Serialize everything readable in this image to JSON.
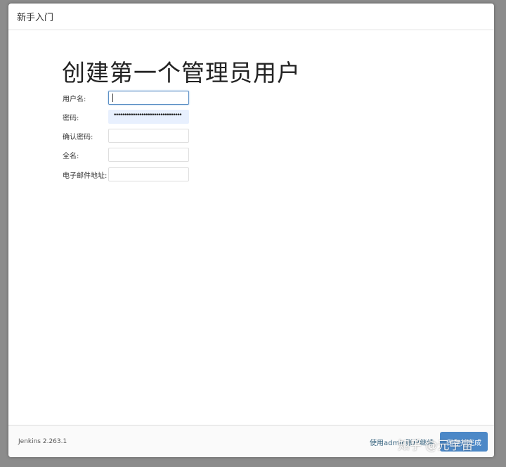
{
  "window": {
    "title": "新手入门"
  },
  "main": {
    "page_title": "创建第一个管理员用户",
    "fields": [
      {
        "label": "用户名:",
        "value": ""
      },
      {
        "label": "密码:",
        "value": "••••••••••••••••••••••••••••••••"
      },
      {
        "label": "确认密码:",
        "value": ""
      },
      {
        "label": "全名:",
        "value": ""
      },
      {
        "label": "电子邮件地址:",
        "value": ""
      }
    ]
  },
  "footer": {
    "version": "Jenkins 2.263.1",
    "skip_link": "使用admin账户继续",
    "save_button": "保存并完成"
  },
  "watermark": {
    "text": "知乎 @元宇宙"
  },
  "colors": {
    "primary_button": "#4c88c7",
    "link": "#35627e",
    "focus_border": "#5b8fc5",
    "autofill_bg": "#e8f0fe"
  }
}
